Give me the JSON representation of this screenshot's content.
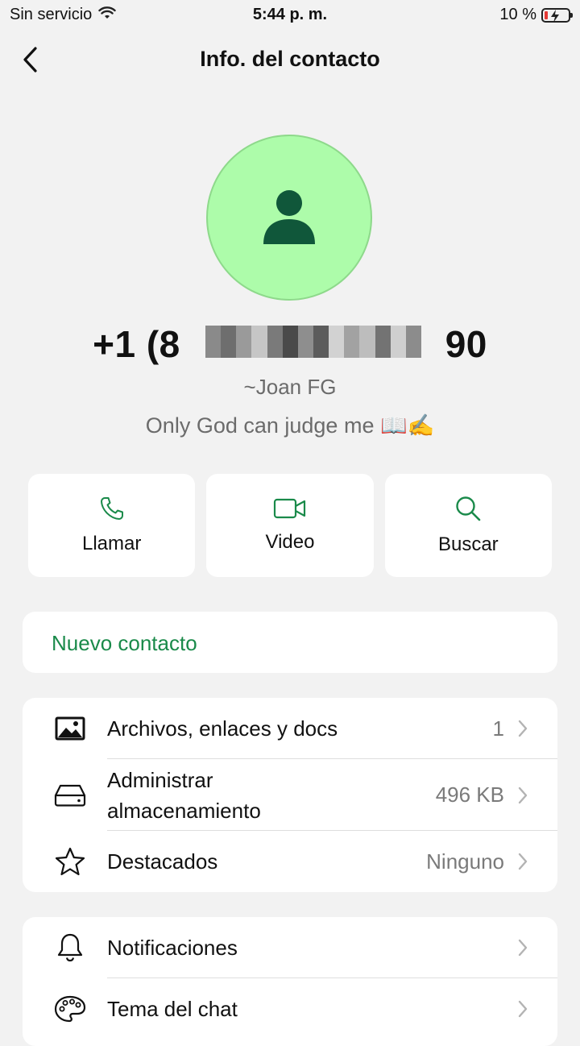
{
  "status_bar": {
    "carrier": "Sin servicio",
    "time": "5:44 p. m.",
    "battery_percent": "10 %"
  },
  "nav": {
    "title": "Info. del contacto"
  },
  "contact": {
    "phone": "+1 (8              90",
    "alias": "~Joan FG",
    "about": "Only God can judge me 📖✍️",
    "avatar_color": "#adfcaa",
    "avatar_icon_color": "#10573a"
  },
  "actions": [
    {
      "label": "Llamar",
      "icon": "phone-icon"
    },
    {
      "label": "Video",
      "icon": "video-icon"
    },
    {
      "label": "Buscar",
      "icon": "search-icon"
    }
  ],
  "accent_color": "#1a8a4a",
  "new_contact": {
    "label": "Nuevo contacto"
  },
  "media_list": [
    {
      "label": "Archivos, enlaces y docs",
      "value": "1",
      "icon": "image-icon"
    },
    {
      "label": "Administrar\nalmacenamiento",
      "value": "496 KB",
      "icon": "storage-icon"
    },
    {
      "label": "Destacados",
      "value": "Ninguno",
      "icon": "star-icon"
    }
  ],
  "settings_list": [
    {
      "label": "Notificaciones",
      "icon": "bell-icon"
    },
    {
      "label": "Tema del chat",
      "icon": "palette-icon"
    }
  ]
}
